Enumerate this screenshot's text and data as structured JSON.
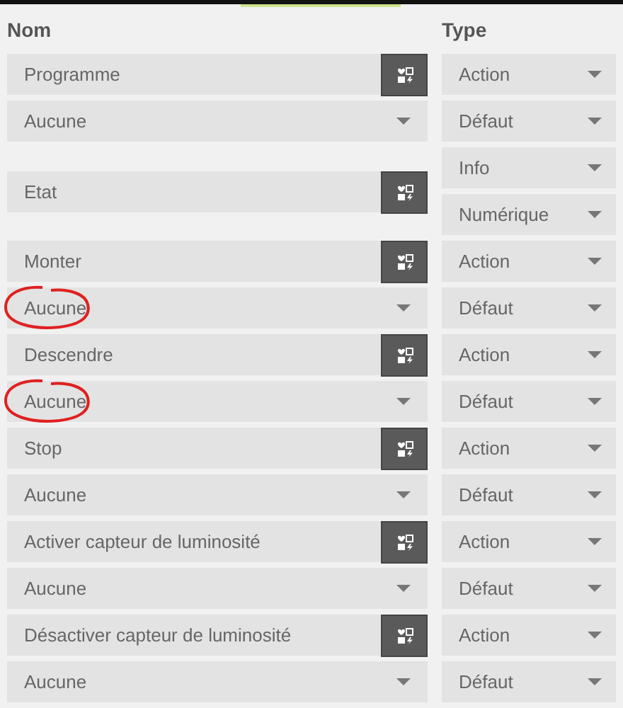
{
  "columns": [
    {
      "label": "Nom"
    },
    {
      "label": "Type"
    }
  ],
  "commands": [
    {
      "kind": "action",
      "name": "Programme",
      "type": "Action",
      "value": "Aucune",
      "subtype": "Défaut",
      "circled": false
    },
    {
      "kind": "info",
      "name": "Etat",
      "type": "Info",
      "subtype": "Numérique"
    },
    {
      "kind": "action",
      "name": "Monter",
      "type": "Action",
      "value": "Aucune",
      "subtype": "Défaut",
      "circled": true
    },
    {
      "kind": "action",
      "name": "Descendre",
      "type": "Action",
      "value": "Aucune",
      "subtype": "Défaut",
      "circled": true
    },
    {
      "kind": "action",
      "name": "Stop",
      "type": "Action",
      "value": "Aucune",
      "subtype": "Défaut",
      "circled": false
    },
    {
      "kind": "action",
      "name": "Activer capteur de luminosité",
      "type": "Action",
      "value": "Aucune",
      "subtype": "Défaut",
      "circled": false
    },
    {
      "kind": "action",
      "name": "Désactiver capteur de luminosité",
      "type": "Action",
      "value": "Aucune",
      "subtype": "Défaut",
      "circled": false
    }
  ]
}
